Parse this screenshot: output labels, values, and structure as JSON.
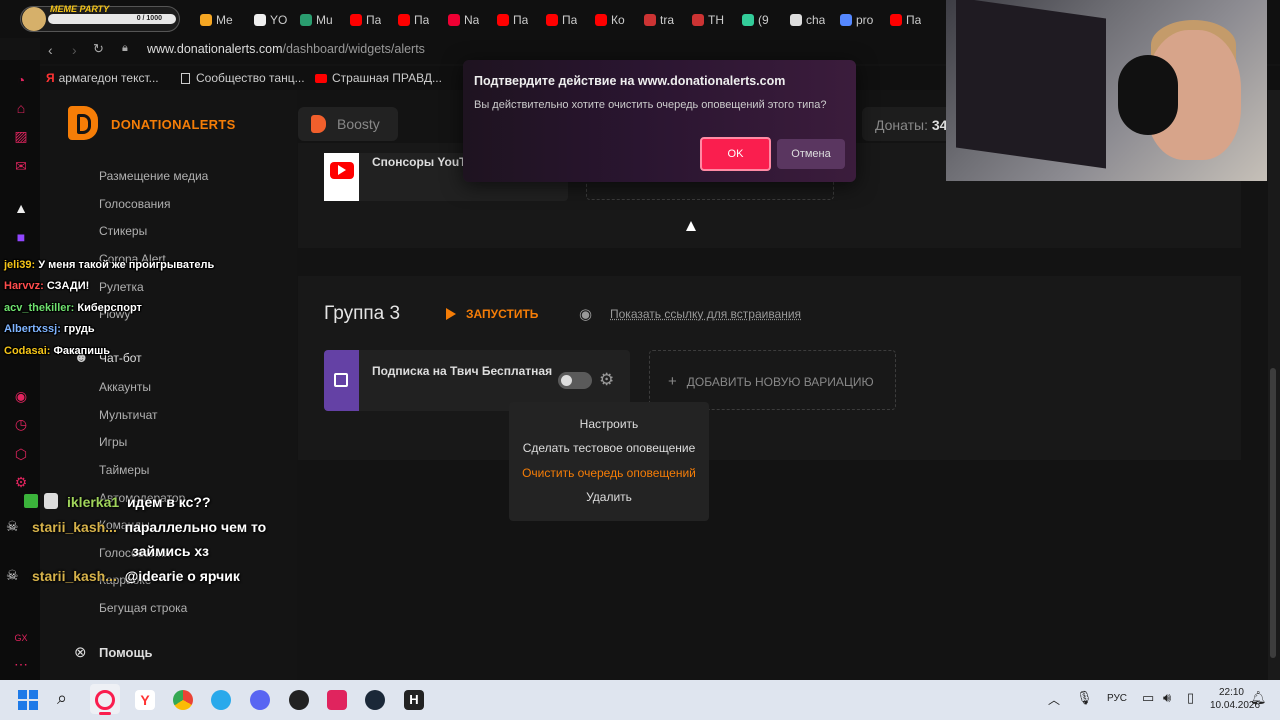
{
  "browser": {
    "meme_party": {
      "title": "MEME PARTY",
      "counter": "0 / 1000"
    },
    "tabs": [
      "Me",
      "YO",
      "Mu",
      "Па",
      "Па",
      "Na",
      "Па",
      "Па",
      "Ко",
      "tra",
      "TH",
      "(9",
      "cha",
      "pro",
      "Па"
    ],
    "url_host": "www.donationalerts.com",
    "url_path": "/dashboard/widgets/alerts",
    "bookmarks": [
      "армагедон текст...",
      "Сообщество танц...",
      "Страшная ПРАВД..."
    ]
  },
  "site": {
    "logo_text": "DONATIONALERTS",
    "boosty_label": "Boosty",
    "donats_label": "Донаты:",
    "donats_value": "34",
    "nav": [
      "Размещение медиа",
      "Голосования",
      "Стикеры",
      "Corona Alert",
      "Рулетка",
      "Flowy",
      "Чат-бот",
      "Аккаунты",
      "Мультичат",
      "Игры",
      "Таймеры",
      "Автомодератор",
      "Команды",
      "Голосования",
      "Карраоке",
      "Бегущая строка"
    ],
    "help_label": "Помощь",
    "sponsors_label": "Спонсоры YouTu",
    "group3_title": "Группа 3",
    "run_label": "ЗАПУСТИТЬ",
    "embed_label": "Показать ссылку для встраивания",
    "subscription_label": "Подписка на Твич Бесплатная",
    "add_variation_label": "ДОБАВИТЬ НОВУЮ ВАРИАЦИЮ",
    "context_menu": [
      "Настроить",
      "Сделать тестовое оповещение",
      "Очистить очередь оповещений",
      "Удалить"
    ]
  },
  "dialog": {
    "title": "Подтвердите действие на www.donationalerts.com",
    "message": "Вы действительно хотите очистить очередь оповещений этого типа?",
    "ok_label": "OK",
    "cancel_label": "Отмена"
  },
  "chat": [
    {
      "user": "jeli39:",
      "text": "У меня такой же проигрыватель",
      "color": "#f5c518"
    },
    {
      "user": "Harvvz:",
      "text": "СЗАДИ!",
      "color": "#ff4d4d"
    },
    {
      "user": "acv_thekiller:",
      "text": "Киберспорт",
      "color": "#6ee06e"
    },
    {
      "user": "Albertxssj:",
      "text": "грудь",
      "color": "#7fb4ff"
    },
    {
      "user": "Codasai:",
      "text": "Факапишь",
      "color": "#f5c518"
    }
  ],
  "big_chat": [
    {
      "user": "iklerka1",
      "text": "идем в кс??",
      "color": "#9fd35a"
    },
    {
      "user": "starii_kash...",
      "text": "параллельно чем то",
      "color": "#d6b24a"
    },
    {
      "user": "",
      "text": "займись хз",
      "color": "#d6b24a"
    },
    {
      "user": "starii_kash...",
      "text": "@idearie о ярчик",
      "color": "#d6b24a"
    }
  ],
  "taskbar": {
    "lang": "РУС",
    "time": "22:10",
    "date": "10.04.2026"
  },
  "colors": {
    "accent": "#f57d07",
    "ok_button": "#fa1e4e",
    "twitch": "#6441a5"
  }
}
